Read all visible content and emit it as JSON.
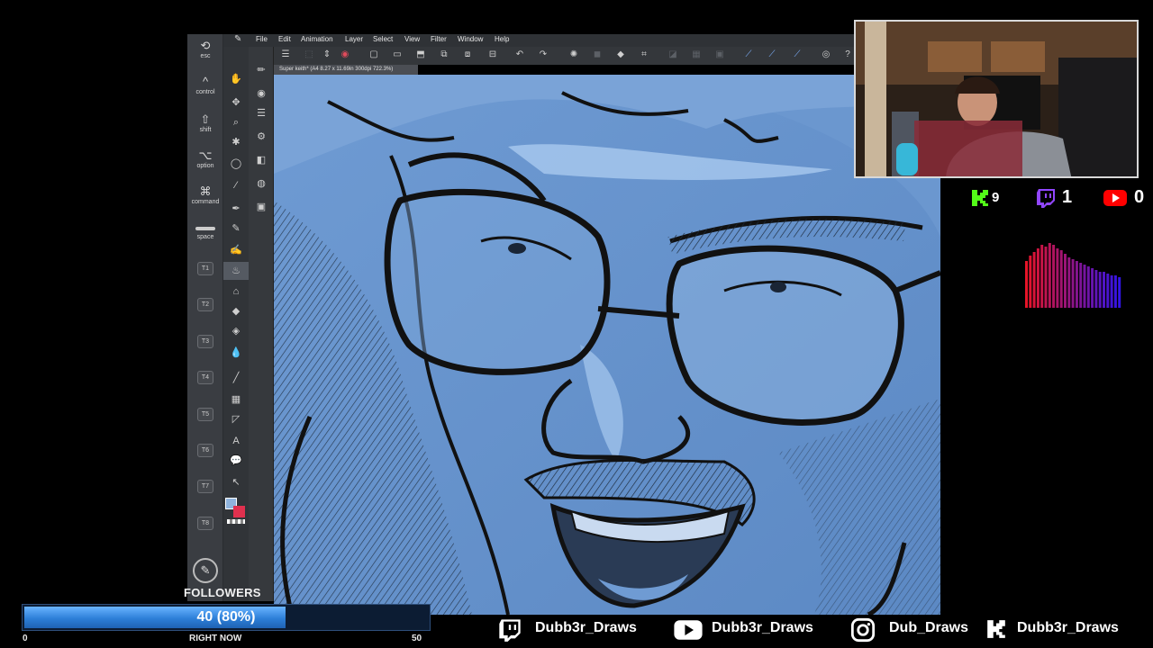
{
  "menu": {
    "items": [
      "File",
      "Edit",
      "Animation",
      "Layer",
      "Select",
      "View",
      "Filter",
      "Window",
      "Help"
    ]
  },
  "document_tab": {
    "title": "Super keith* (A4 8.27 x 11.69in 300dpi 722.3%)"
  },
  "shortcut_bar": {
    "esc": "esc",
    "control": "control",
    "shift": "shift",
    "option": "option",
    "command": "command",
    "space": "space",
    "tabs": [
      "T1",
      "T2",
      "T3",
      "T4",
      "T5",
      "T6",
      "T7",
      "T8"
    ]
  },
  "counters": {
    "kick": "9",
    "twitch": "1",
    "youtube": "0"
  },
  "followers": {
    "label": "FOLLOWERS",
    "text": "40 (80%)",
    "progress": 0.8,
    "min": "0",
    "now": "RIGHT NOW",
    "max": "50"
  },
  "socials": {
    "twitch": "Dubb3r_Draws",
    "youtube": "Dubb3r_Draws",
    "instagram": "Dub_Draws",
    "kick": "Dubb3r_Draws"
  },
  "colors": {
    "main_color": "#8fb3dc",
    "sub_color": "#e0304e",
    "kick_green": "#53fc18",
    "twitch_purple": "#9146ff",
    "youtube_red": "#ff0000",
    "progress_blue": "#3b8fea"
  }
}
